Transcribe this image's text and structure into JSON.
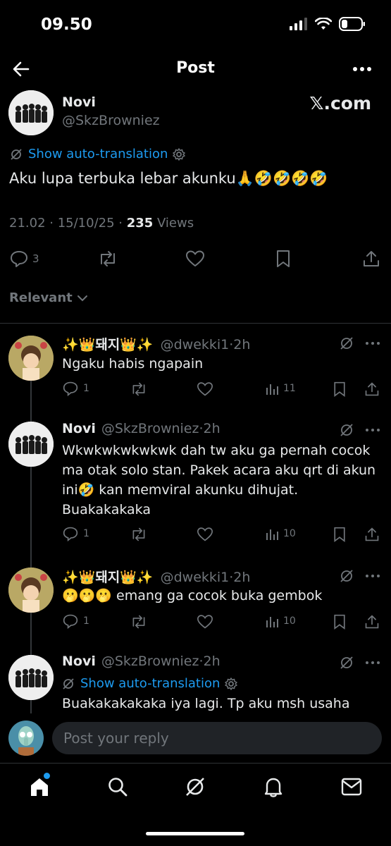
{
  "status_bar": {
    "time": "09.50"
  },
  "header": {
    "title": "Post"
  },
  "post": {
    "name": "Novi",
    "handle": "@SkzBrowniez",
    "source": "𝕏.com",
    "translation_label": "Show auto-translation",
    "text": "Aku lupa terbuka lebar akunku🙏🤣🤣🤣🤣",
    "meta_time": "21.02 · 15/10/25 · ",
    "views_count": "235",
    "views_label": " Views",
    "reply_count": "3"
  },
  "sort": {
    "label": "Relevant"
  },
  "replies": [
    {
      "name": "✨👑돼지👑✨",
      "handle": "@dwekki1·2h",
      "text": "Ngaku habis ngapain",
      "reply_count": "1",
      "views": "11"
    },
    {
      "name": "Novi",
      "handle": "@SkzBrowniez·2h",
      "text": "Wkwkwkwkwkwk dah tw aku ga pernah cocok ma otak solo stan. Pakek acara aku qrt di akun ini🤣 kan memviral akunku dihujat. Buakakakaka",
      "reply_count": "1",
      "views": "10"
    },
    {
      "name": "✨👑돼지👑✨",
      "handle": "@dwekki1·2h",
      "text": "🫢🫢🫢 emang ga cocok buka gembok",
      "reply_count": "1",
      "views": "10"
    },
    {
      "name": "Novi",
      "handle": "@SkzBrowniez·2h",
      "translation_label": "Show auto-translation",
      "text": "Buakakakakaka iya lagi. Tp aku msh usaha"
    }
  ],
  "reply_bar": {
    "placeholder": "Post your reply"
  },
  "nav": [
    "home-icon",
    "search-icon",
    "grok-icon",
    "notifications-icon",
    "messages-icon"
  ],
  "colors": {
    "background": "#000000",
    "text": "#e7e9ea",
    "muted": "#71767b",
    "accent": "#1d9bf0"
  }
}
